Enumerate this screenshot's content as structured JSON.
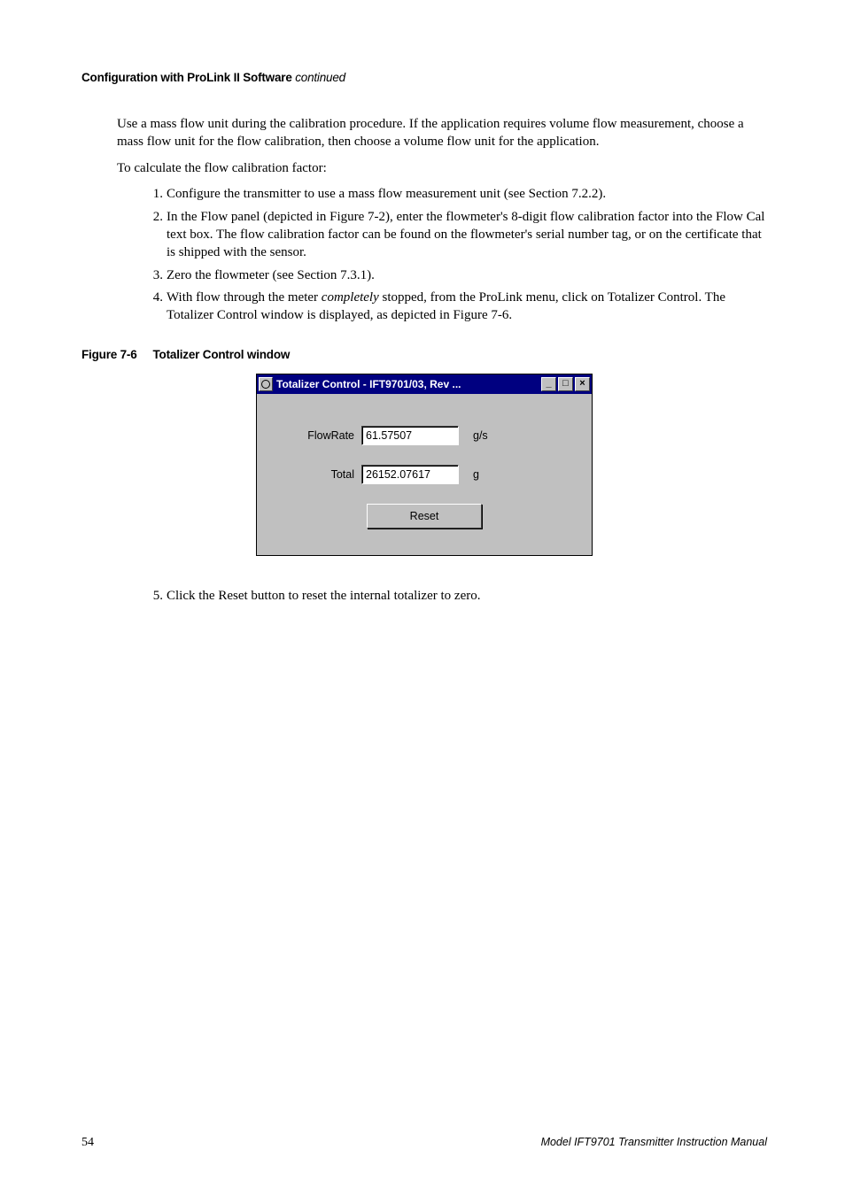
{
  "header": {
    "bold": "Configuration with ProLink II Software",
    "italic": " continued"
  },
  "body": {
    "p1": "Use a mass flow unit during the calibration procedure. If the application requires volume flow measurement, choose a mass flow unit for the flow calibration, then choose a volume flow unit for the application.",
    "p2": "To calculate the flow calibration factor:",
    "li1": "Configure the transmitter to use a mass flow measurement unit (see Section 7.2.2).",
    "li2": "In the Flow panel (depicted in Figure 7-2), enter the flowmeter's 8-digit flow calibration factor into the Flow Cal text box. The flow calibration factor can be found on the flowmeter's serial number tag, or on the certificate that is shipped with the sensor.",
    "li3": "Zero the flowmeter (see Section 7.3.1).",
    "li4a": "With flow through the meter ",
    "li4b": "completely",
    "li4c": " stopped, from the ProLink menu, click on Totalizer Control. The Totalizer Control window is displayed, as depicted in Figure 7-6.",
    "li5": "Click the Reset button to reset the internal totalizer to zero."
  },
  "figure": {
    "caption_num": "Figure 7-6",
    "caption_title": "Totalizer Control window",
    "window_title": "Totalizer Control - IFT9701/03, Rev ...",
    "flowrate_label": "FlowRate",
    "flowrate_value": "61.57507",
    "flowrate_unit": "g/s",
    "total_label": "Total",
    "total_value": "26152.07617",
    "total_unit": "g",
    "reset_label": "Reset"
  },
  "footer": {
    "page": "54",
    "manual": "Model IFT9701 Transmitter Instruction Manual"
  },
  "list_numbers": {
    "n1": "1.",
    "n2": "2.",
    "n3": "3.",
    "n4": "4.",
    "n5": "5."
  }
}
